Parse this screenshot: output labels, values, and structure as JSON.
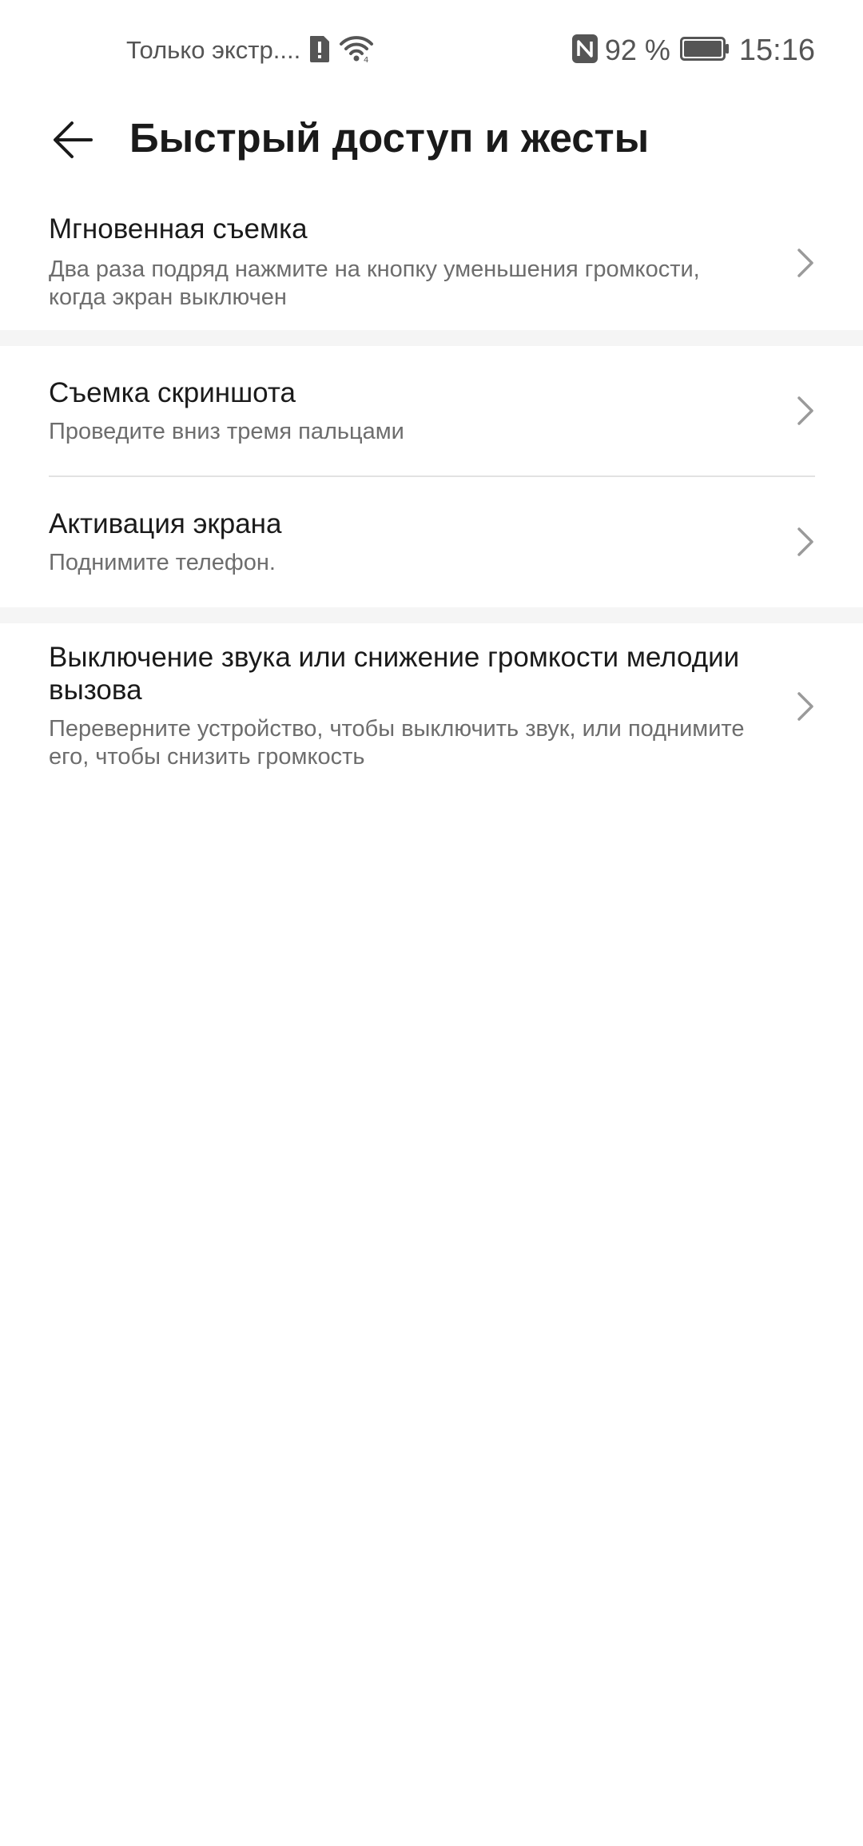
{
  "status_bar": {
    "carrier": "Только экстр....",
    "sim_icon": "sim-alert-icon",
    "wifi_icon": "wifi-icon",
    "nfc_icon": "nfc-icon",
    "battery_percent": "92 %",
    "battery_icon": "battery-icon",
    "battery_level": 0.92,
    "time": "15:16"
  },
  "header": {
    "back_icon": "arrow-left-icon",
    "title": "Быстрый доступ и жесты"
  },
  "items": [
    {
      "title": "Мгновенная съемка",
      "subtitle": "Два раза подряд нажмите на кнопку уменьшения громкости, когда экран выключен"
    },
    {
      "title": "Съемка скриншота",
      "subtitle": "Проведите вниз тремя пальцами"
    },
    {
      "title": "Активация экрана",
      "subtitle": "Поднимите телефон."
    },
    {
      "title": "Выключение звука или снижение громкости мелодии вызова",
      "subtitle": "Переверните устройство, чтобы выключить звук, или поднимите его, чтобы снизить громкость"
    }
  ],
  "colors": {
    "background": "#ffffff",
    "section_gap": "#f5f5f5",
    "primary_text": "#1a1a1a",
    "secondary_text": "#6d6d6d",
    "chevron": "#9a9a9a"
  }
}
